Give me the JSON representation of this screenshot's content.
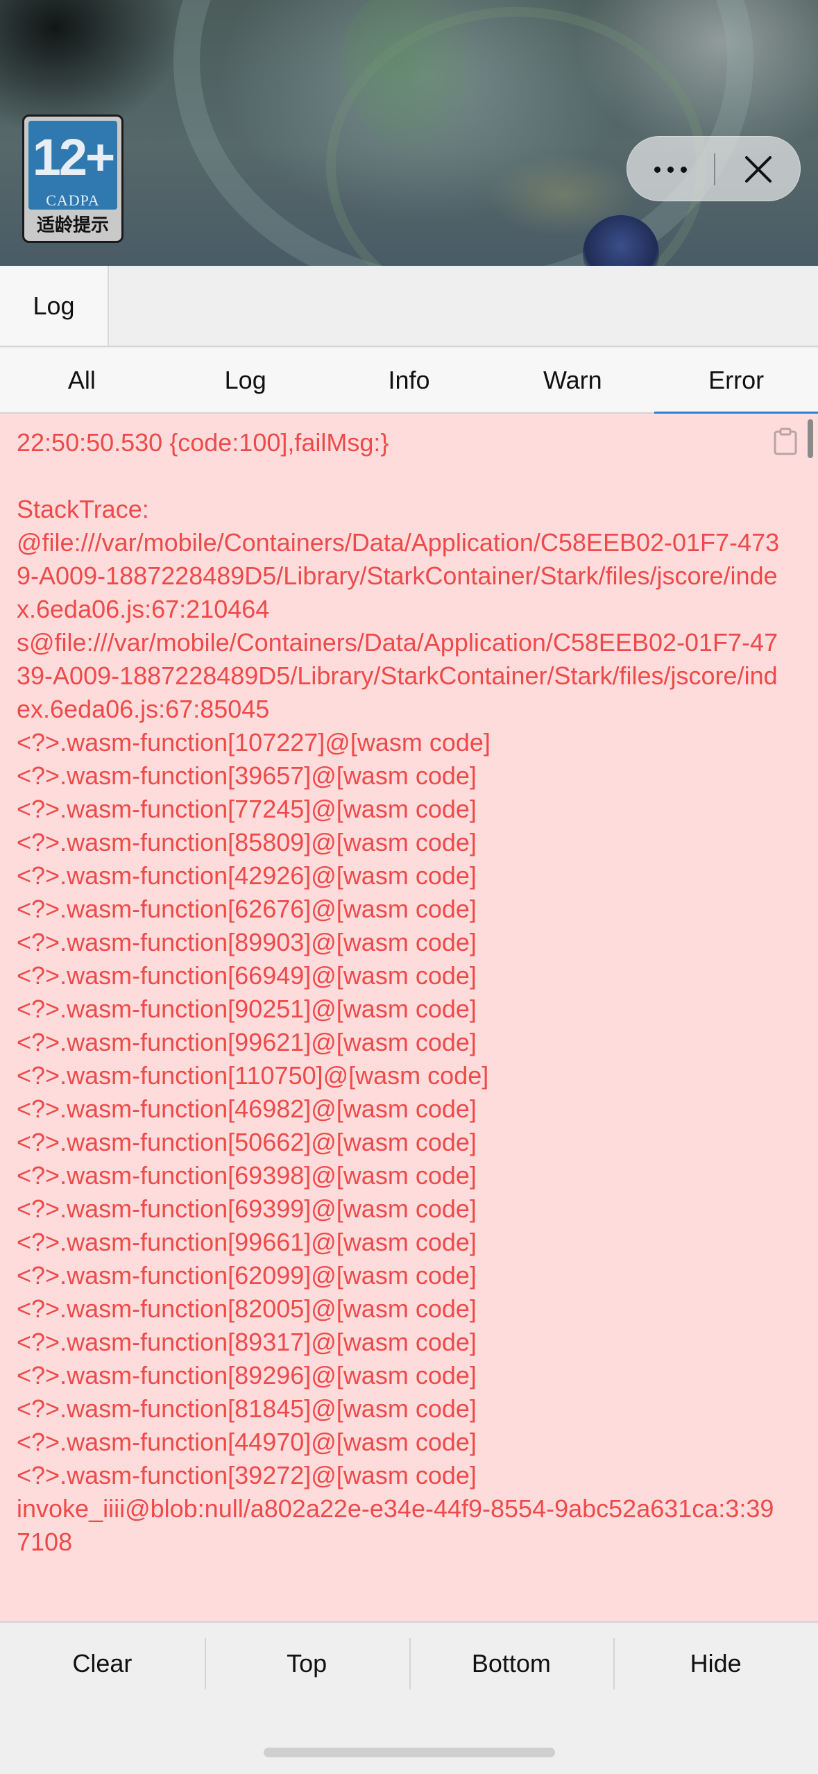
{
  "age_rating": {
    "number": "12+",
    "org": "CADPA",
    "caption": "适龄提示"
  },
  "capsule": {
    "more_icon": "ellipsis-icon",
    "close_icon": "close-icon"
  },
  "panel": {
    "tabs": [
      {
        "label": "Log"
      }
    ],
    "filters": [
      {
        "label": "All",
        "active": false
      },
      {
        "label": "Log",
        "active": false
      },
      {
        "label": "Info",
        "active": false
      },
      {
        "label": "Warn",
        "active": false
      },
      {
        "label": "Error",
        "active": true
      }
    ],
    "log_lines": [
      "22:50:50.530 {code:100],failMsg:}",
      "",
      "StackTrace:",
      "@file:///var/mobile/Containers/Data/Application/C58EEB02-01F7-4739-A009-1887228489D5/Library/StarkContainer/Stark/files/jscore/index.6eda06.js:67:210464",
      "s@file:///var/mobile/Containers/Data/Application/C58EEB02-01F7-4739-A009-1887228489D5/Library/StarkContainer/Stark/files/jscore/index.6eda06.js:67:85045",
      "<?>.wasm-function[107227]@[wasm code]",
      "<?>.wasm-function[39657]@[wasm code]",
      "<?>.wasm-function[77245]@[wasm code]",
      "<?>.wasm-function[85809]@[wasm code]",
      "<?>.wasm-function[42926]@[wasm code]",
      "<?>.wasm-function[62676]@[wasm code]",
      "<?>.wasm-function[89903]@[wasm code]",
      "<?>.wasm-function[66949]@[wasm code]",
      "<?>.wasm-function[90251]@[wasm code]",
      "<?>.wasm-function[99621]@[wasm code]",
      "<?>.wasm-function[110750]@[wasm code]",
      "<?>.wasm-function[46982]@[wasm code]",
      "<?>.wasm-function[50662]@[wasm code]",
      "<?>.wasm-function[69398]@[wasm code]",
      "<?>.wasm-function[69399]@[wasm code]",
      "<?>.wasm-function[99661]@[wasm code]",
      "<?>.wasm-function[62099]@[wasm code]",
      "<?>.wasm-function[82005]@[wasm code]",
      "<?>.wasm-function[89317]@[wasm code]",
      "<?>.wasm-function[89296]@[wasm code]",
      "<?>.wasm-function[81845]@[wasm code]",
      "<?>.wasm-function[44970]@[wasm code]",
      "<?>.wasm-function[39272]@[wasm code]",
      "invoke_iiii@blob:null/a802a22e-e34e-44f9-8554-9abc52a631ca:3:397108"
    ],
    "bottom_buttons": [
      {
        "label": "Clear"
      },
      {
        "label": "Top"
      },
      {
        "label": "Bottom"
      },
      {
        "label": "Hide"
      }
    ]
  },
  "colors": {
    "error_text": "#ee4a4a",
    "error_bg": "#ffdcdc",
    "active_tab_underline": "#2b7fd4"
  }
}
